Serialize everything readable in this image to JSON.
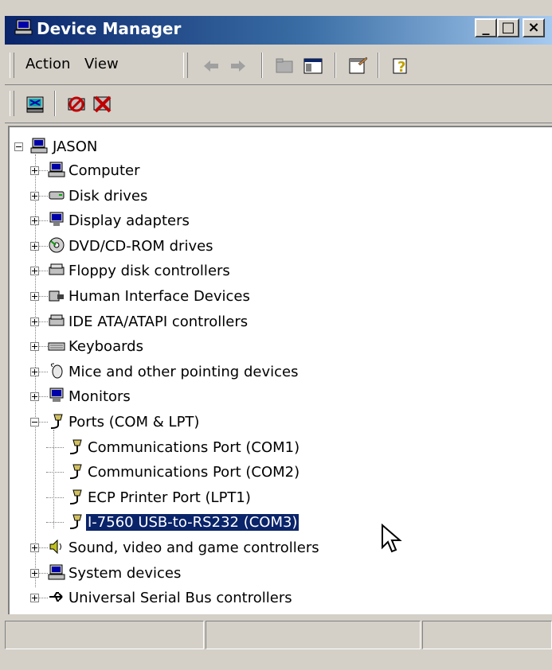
{
  "window": {
    "title": "Device Manager"
  },
  "caption_buttons": {
    "minimize": "_",
    "maximize": "□",
    "close": "×"
  },
  "menu": {
    "action": "Action",
    "view": "View"
  },
  "tree": {
    "root": "JASON",
    "categories": [
      {
        "label": "Computer",
        "icon": "computer-icon"
      },
      {
        "label": "Disk drives",
        "icon": "disk-drive-icon"
      },
      {
        "label": "Display adapters",
        "icon": "display-adapter-icon"
      },
      {
        "label": "DVD/CD-ROM drives",
        "icon": "dvd-icon"
      },
      {
        "label": "Floppy disk controllers",
        "icon": "floppy-controller-icon"
      },
      {
        "label": "Human Interface Devices",
        "icon": "hid-icon"
      },
      {
        "label": "IDE ATA/ATAPI controllers",
        "icon": "ide-controller-icon"
      },
      {
        "label": "Keyboards",
        "icon": "keyboard-icon"
      },
      {
        "label": "Mice and other pointing devices",
        "icon": "mouse-icon"
      },
      {
        "label": "Monitors",
        "icon": "monitor-icon"
      },
      {
        "label": "Ports (COM & LPT)",
        "icon": "port-icon"
      },
      {
        "label": "Sound, video and game controllers",
        "icon": "sound-icon"
      },
      {
        "label": "System devices",
        "icon": "system-icon"
      },
      {
        "label": "Universal Serial Bus controllers",
        "icon": "usb-icon"
      }
    ],
    "ports_children": [
      "Communications Port (COM1)",
      "Communications Port (COM2)",
      "ECP Printer Port (LPT1)",
      "I-7560 USB-to-RS232 (COM3)"
    ],
    "selected": "I-7560 USB-to-RS232 (COM3)"
  },
  "colors": {
    "title_start": "#0a246a",
    "title_end": "#a6caf0",
    "selection": "#0a246a",
    "face": "#d4d0c8"
  }
}
